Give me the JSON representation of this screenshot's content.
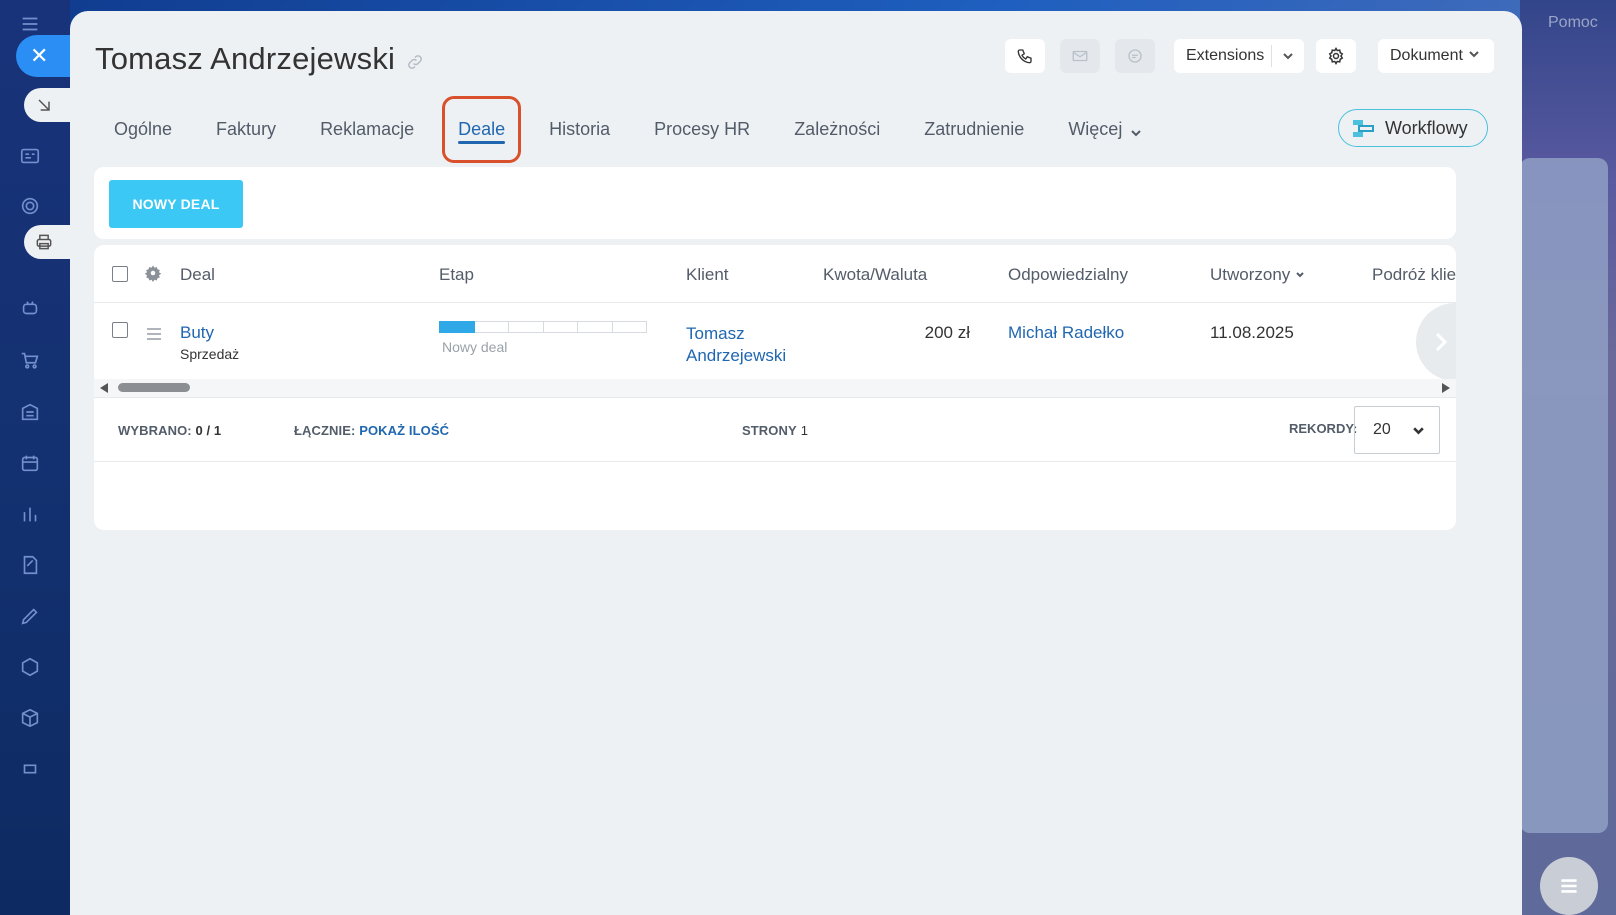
{
  "background": {
    "help_label": "Pomoc"
  },
  "header": {
    "title": "Tomasz Andrzejewski",
    "extensions_label": "Extensions",
    "document_label": "Dokument"
  },
  "tabs": [
    {
      "label": "Ogólne"
    },
    {
      "label": "Faktury"
    },
    {
      "label": "Reklamacje"
    },
    {
      "label": "Deale",
      "active": true
    },
    {
      "label": "Historia"
    },
    {
      "label": "Procesy HR"
    },
    {
      "label": "Zależności"
    },
    {
      "label": "Zatrudnienie"
    },
    {
      "label": "Więcej"
    }
  ],
  "workflow_label": "Workflowy",
  "toolbar": {
    "new_deal_label": "NOWY DEAL"
  },
  "grid": {
    "columns": {
      "deal": "Deal",
      "stage": "Etap",
      "client": "Klient",
      "amount": "Kwota/Waluta",
      "responsible": "Odpowiedzialny",
      "created": "Utworzony",
      "journey": "Podróż klie"
    },
    "rows": [
      {
        "deal": "Buty",
        "deal_type": "Sprzedaż",
        "stage": "Nowy deal",
        "client": "Tomasz Andrzejewski",
        "amount": "200 zł",
        "responsible": "Michał Radełko",
        "created": "11.08.2025"
      }
    ]
  },
  "footer": {
    "selected_label": "WYBRANO:",
    "selected_value": "0 / 1",
    "total_label": "ŁĄCZNIE:",
    "total_link": "POKAŻ ILOŚĆ",
    "pages_label": "STRONY",
    "pages_value": "1",
    "records_label": "REKORDY:",
    "records_value": "20"
  },
  "colors": {
    "accent": "#2067b0",
    "new_deal_button": "#3bc8f5",
    "highlight": "#d9512c"
  }
}
